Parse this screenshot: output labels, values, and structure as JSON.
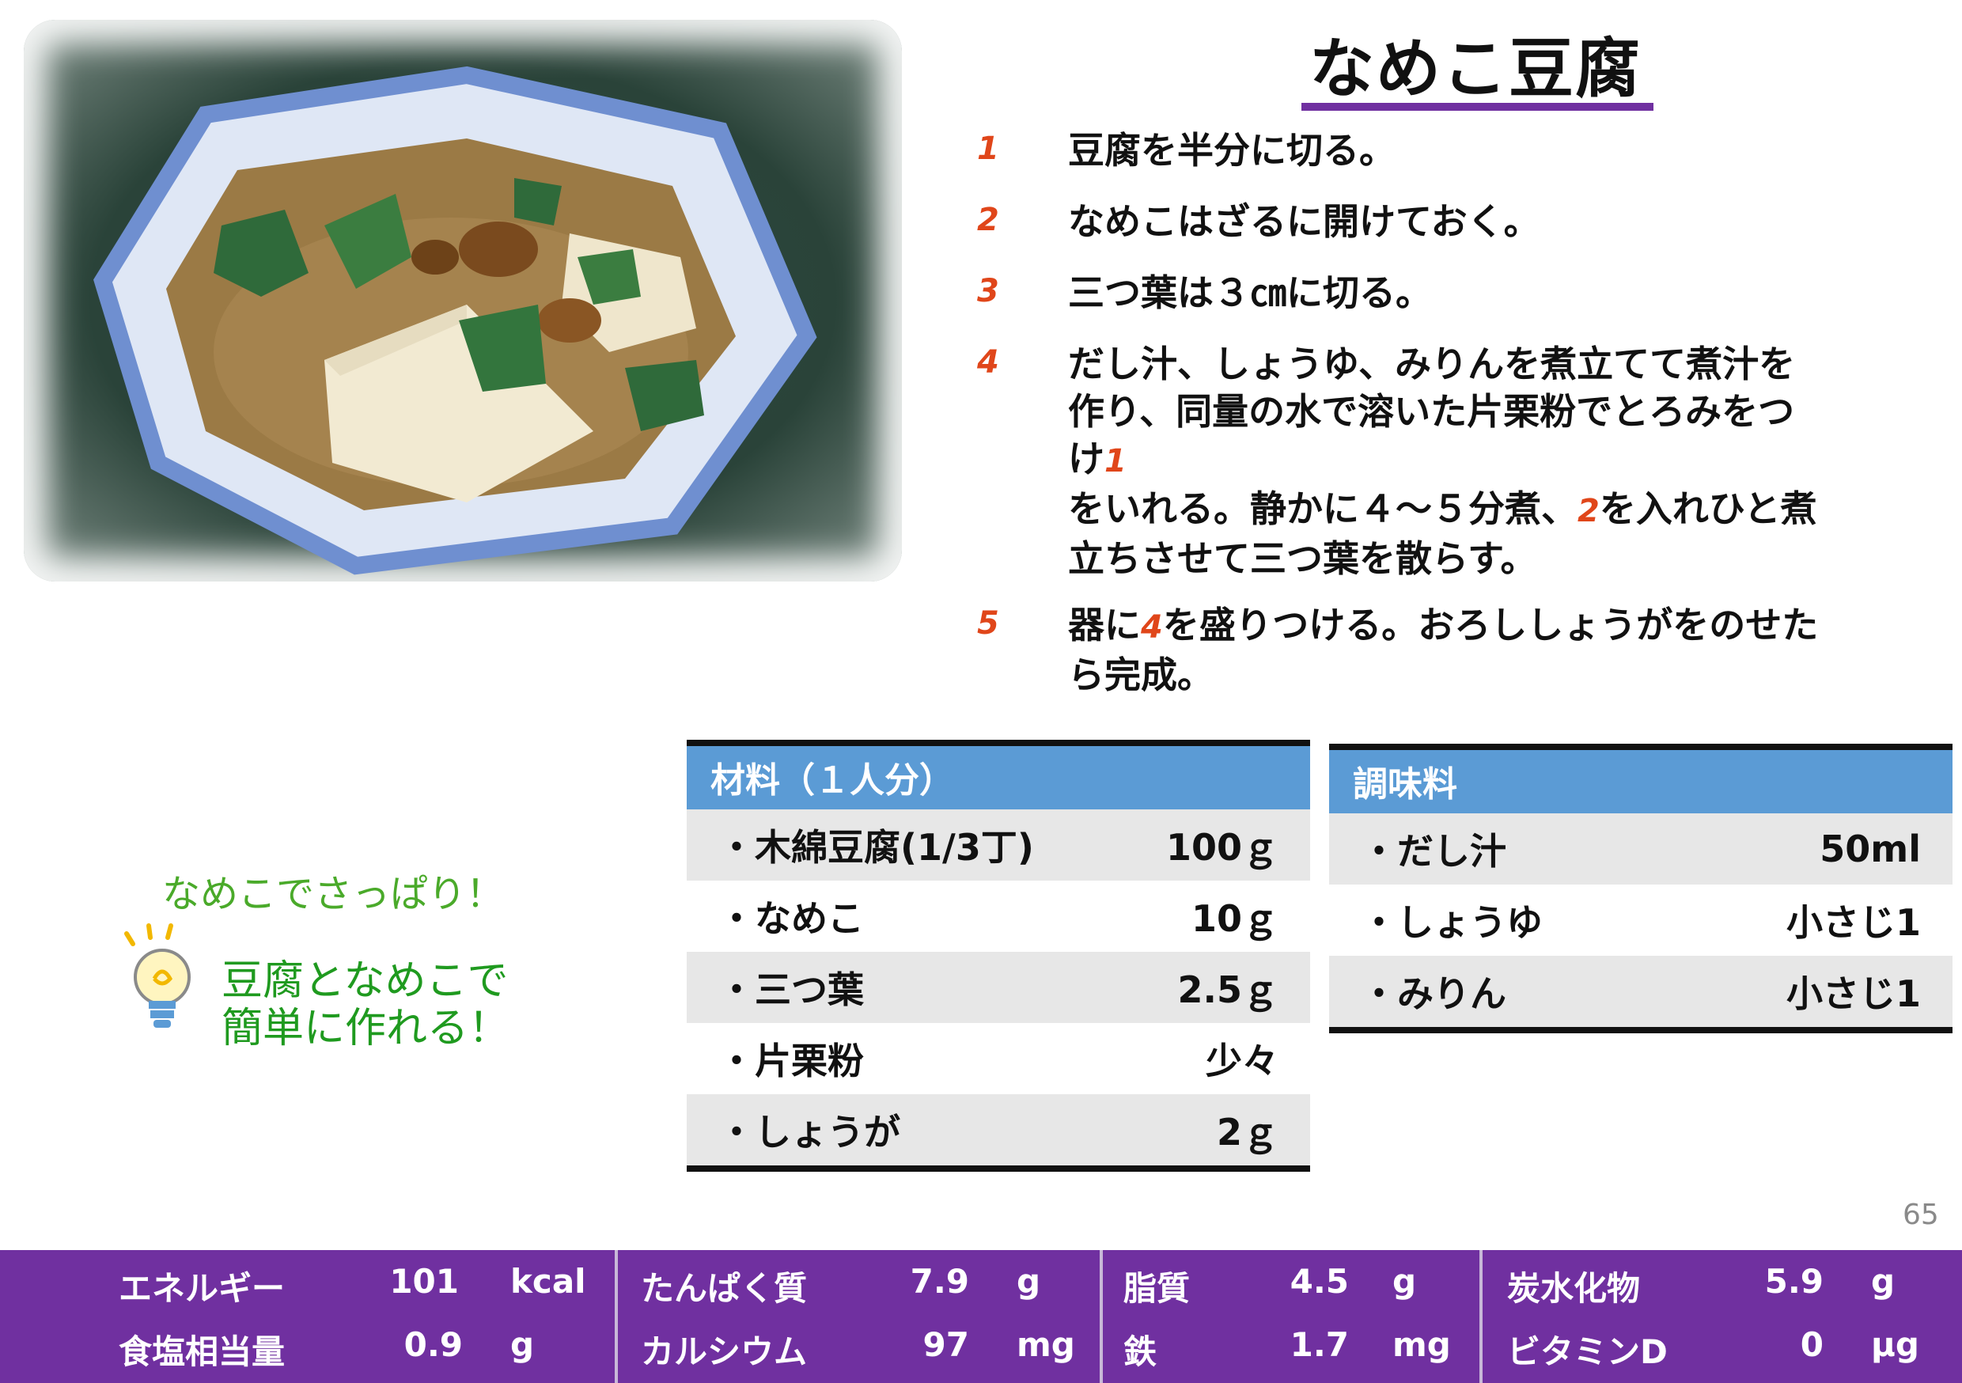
{
  "title": "なめこ豆腐",
  "steps": [
    {
      "num": "1",
      "text": "豆腐を半分に切る。"
    },
    {
      "num": "2",
      "text": "なめこはざるに開けておく。"
    },
    {
      "num": "3",
      "text": "三つ葉は３㎝に切る。"
    },
    {
      "num": "4",
      "line1": "だし汁、しょうゆ、みりんを煮立てて煮汁を",
      "line2": "作り、同量の水で溶いた片栗粉でとろみをつ",
      "line3a": "け",
      "ref1": "1",
      "line4a": "をいれる。静かに４～５分煮、",
      "ref2": "2",
      "line4b": "を入れひと煮",
      "line5": "立ちさせて三つ葉を散らす。"
    },
    {
      "num": "5",
      "line1a": "器に",
      "ref": "4",
      "line1b": "を盛りつける。おろししょうがをのせた",
      "line2": "ら完成。"
    }
  ],
  "ingredients": {
    "header": "材料（１人分）",
    "rows": [
      {
        "name": "・木綿豆腐(1/3丁)",
        "amount": "100ｇ"
      },
      {
        "name": "・なめこ",
        "amount": "10ｇ"
      },
      {
        "name": "・三つ葉",
        "amount": "2.5ｇ"
      },
      {
        "name": "・片栗粉",
        "amount": "少々"
      },
      {
        "name": "・しょうが",
        "amount": "2ｇ"
      }
    ]
  },
  "seasonings": {
    "header": "調味料",
    "rows": [
      {
        "name": "・だし汁",
        "amount": "50ml"
      },
      {
        "name": "・しょうゆ",
        "amount": "小さじ1"
      },
      {
        "name": "・みりん",
        "amount": "小さじ1"
      }
    ]
  },
  "tip": {
    "line1": "なめこでさっぱり！",
    "line2": "豆腐となめこで",
    "line3": "簡単に作れる！"
  },
  "page_number": "65",
  "nutrition": [
    {
      "label": "エネルギー",
      "value": "101",
      "unit": "kcal"
    },
    {
      "label": "食塩相当量",
      "value": "0.9",
      "unit": "g"
    },
    {
      "label": "たんぱく質",
      "value": "7.9",
      "unit": "g"
    },
    {
      "label": "カルシウム",
      "value": "97",
      "unit": "mg"
    },
    {
      "label": "脂質",
      "value": "4.5",
      "unit": "g"
    },
    {
      "label": "鉄",
      "value": "1.7",
      "unit": "mg"
    },
    {
      "label": "炭水化物",
      "value": "5.9",
      "unit": "g"
    },
    {
      "label": "ビタミンD",
      "value": "0",
      "unit": "μg"
    }
  ],
  "colors": {
    "accent_purple": "#7030a0",
    "header_blue": "#5b9bd5",
    "step_red": "#e0461a",
    "tip_green": "#1f9a1f"
  }
}
